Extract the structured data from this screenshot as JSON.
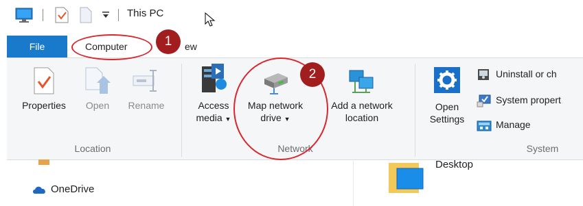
{
  "window": {
    "title": "This PC"
  },
  "quick_access": {
    "icons": [
      "computer-icon",
      "properties-check-icon",
      "new-folder-icon",
      "customize-dropdown-icon"
    ]
  },
  "tabs": {
    "file": "File",
    "computer": "Computer",
    "view_partial": "ew"
  },
  "groups": {
    "location": {
      "label": "Location",
      "properties": "Properties",
      "open": "Open",
      "rename": "Rename"
    },
    "network": {
      "label": "Network",
      "access_media_1": "Access",
      "access_media_2": "media",
      "map_drive_1": "Map network",
      "map_drive_2": "drive",
      "add_location_1": "Add a network",
      "add_location_2": "location"
    },
    "system": {
      "label": "System",
      "open_settings_1": "Open",
      "open_settings_2": "Settings",
      "uninstall": "Uninstall or ch",
      "system_properties": "System propert",
      "manage": "Manage"
    }
  },
  "annotations": {
    "badge1": "1",
    "badge2": "2"
  },
  "nav": {
    "onedrive": "OneDrive",
    "desktop": "Desktop"
  },
  "colors": {
    "file_tab": "#1979ca",
    "annotation_red": "#d9262e",
    "badge": "#a21e1e",
    "ribbon_bg": "#f5f6f7"
  }
}
